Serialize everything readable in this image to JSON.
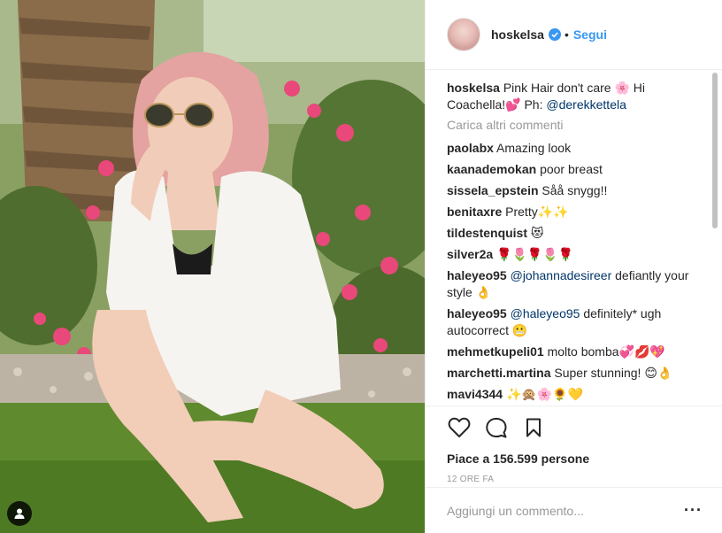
{
  "post": {
    "author": "hoskelsa",
    "follow_label": "Segui",
    "separator": "•",
    "caption": {
      "user": "hoskelsa",
      "text": "Pink Hair don't care 🌸 Hi Coachella!💕 Ph: ",
      "mention": "@derekkettela"
    },
    "load_more_label": "Carica altri commenti",
    "comments": [
      {
        "user": "paolabx",
        "text": "Amazing look",
        "mention": ""
      },
      {
        "user": "kaanademokan",
        "text": "poor breast",
        "mention": ""
      },
      {
        "user": "sissela_epstein",
        "text": "Såå snygg!!",
        "mention": ""
      },
      {
        "user": "benitaxre",
        "text": "Pretty✨✨",
        "mention": ""
      },
      {
        "user": "tildestenquist",
        "text": "😻",
        "mention": ""
      },
      {
        "user": "silver2a",
        "text": "🌹🌷🌹🌷🌹",
        "mention": ""
      },
      {
        "user": "haleyeo95",
        "mention": "@johannadesireer",
        "text": " defiantly your style 👌"
      },
      {
        "user": "haleyeo95",
        "mention": "@haleyeo95",
        "text": " definitely* ugh autocorrect 😬"
      },
      {
        "user": "mehmetkupeli01",
        "text": "molto bomba💞💋💖",
        "mention": ""
      },
      {
        "user": "marchetti.martina",
        "text": "Super stunning! 😊👌",
        "mention": ""
      },
      {
        "user": "mavi4344",
        "text": "✨🙊🌸🌻💛",
        "mention": ""
      }
    ],
    "likes_label": "Piace a 156.599 persone",
    "time_label": "12 ORE FA",
    "comment_input": {
      "placeholder": "Aggiungi un commento...",
      "value": ""
    },
    "more_label": "···"
  },
  "icons": {
    "like": "heart-icon",
    "comment": "comment-bubble-icon",
    "save": "bookmark-icon",
    "tag": "user-tag-icon",
    "verified": "verified-badge-icon"
  },
  "colors": {
    "link_blue": "#3897f0",
    "mention_blue": "#003569",
    "muted": "#999999",
    "text": "#262626",
    "border": "#efefef"
  }
}
